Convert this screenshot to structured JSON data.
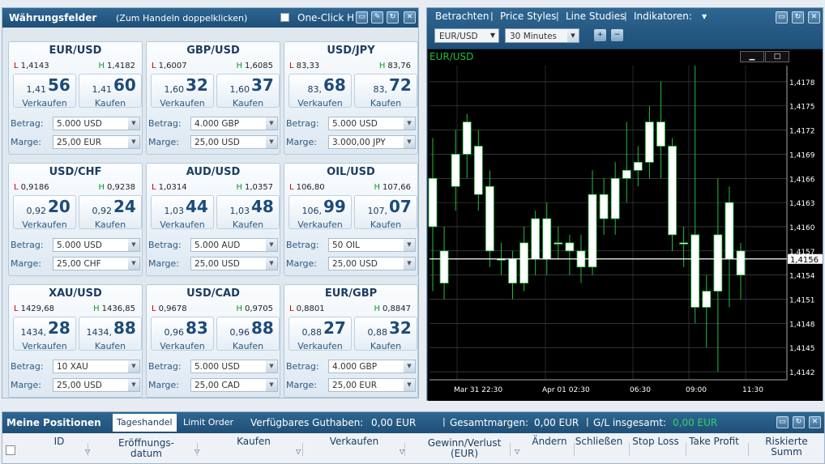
{
  "currency_panel": {
    "title": "Währungsfelder",
    "subtitle": "(Zum Handeln doppelklicken)",
    "oneclick": "One-Click H"
  },
  "labels": {
    "sell": "Verkaufen",
    "buy": "Kaufen",
    "amount": "Betrag:",
    "margin": "Marge:",
    "low": "L",
    "high": "H"
  },
  "cards": [
    {
      "pair": "EUR/USD",
      "low": "1,4143",
      "high": "1,4182",
      "sell_pre": "1,41",
      "sell_big": "56",
      "buy_pre": "1,41",
      "buy_big": "60",
      "amount": "5.000 USD",
      "margin": "25,00 EUR"
    },
    {
      "pair": "GBP/USD",
      "low": "1,6007",
      "high": "1,6085",
      "sell_pre": "1,60",
      "sell_big": "32",
      "buy_pre": "1,60",
      "buy_big": "37",
      "amount": "4.000 GBP",
      "margin": "25,00 USD"
    },
    {
      "pair": "USD/JPY",
      "low": "83,33",
      "high": "83,76",
      "sell_pre": "83,",
      "sell_big": "68",
      "buy_pre": "83,",
      "buy_big": "72",
      "amount": "5.000 USD",
      "margin": "3.000,00 JPY"
    },
    {
      "pair": "USD/CHF",
      "low": "0,9186",
      "high": "0,9238",
      "sell_pre": "0,92",
      "sell_big": "20",
      "buy_pre": "0,92",
      "buy_big": "24",
      "amount": "5.000 USD",
      "margin": "25,00 CHF"
    },
    {
      "pair": "AUD/USD",
      "low": "1,0314",
      "high": "1,0357",
      "sell_pre": "1,03",
      "sell_big": "44",
      "buy_pre": "1,03",
      "buy_big": "48",
      "amount": "5.000 AUD",
      "margin": "25,00 USD"
    },
    {
      "pair": "OIL/USD",
      "low": "106,80",
      "high": "107,66",
      "sell_pre": "106,",
      "sell_big": "99",
      "buy_pre": "107,",
      "buy_big": "07",
      "amount": "50 OIL",
      "margin": "25,00 USD"
    },
    {
      "pair": "XAU/USD",
      "low": "1429,68",
      "high": "1436,85",
      "sell_pre": "1434,",
      "sell_big": "28",
      "buy_pre": "1434,",
      "buy_big": "88",
      "amount": "10 XAU",
      "margin": "25,00 USD"
    },
    {
      "pair": "USD/CAD",
      "low": "0,9678",
      "high": "0,9705",
      "sell_pre": "0,96",
      "sell_big": "83",
      "buy_pre": "0,96",
      "buy_big": "88",
      "amount": "5.000 USD",
      "margin": "25,00 CAD"
    },
    {
      "pair": "EUR/GBP",
      "low": "0,8801",
      "high": "0,8847",
      "sell_pre": "0,88",
      "sell_big": "27",
      "buy_pre": "0,88",
      "buy_big": "32",
      "amount": "4.000 GBP",
      "margin": "25,00 EUR"
    }
  ],
  "chart_panel": {
    "menu": [
      "Betrachten",
      "Price Styles",
      "Line Studies",
      "Indikatoren:"
    ],
    "symbol": "EUR/USD",
    "timeframe": "30 Minutes",
    "label": "EUR/USD",
    "current_price": "1,4156"
  },
  "chart_data": {
    "type": "candlestick",
    "symbol": "EUR/USD",
    "y_ticks": [
      "1,4178",
      "1,4175",
      "1,4172",
      "1,4169",
      "1,4166",
      "1,4163",
      "1,4160",
      "1,4157",
      "1,4154",
      "1,4151",
      "1,4148",
      "1,4145",
      "1,4142"
    ],
    "x_ticks": [
      "Mar 31 22:30",
      "Apr 01 02:30",
      "06:30",
      "09:00",
      "11:30"
    ],
    "ylim": [
      1.4141,
      1.418
    ],
    "current": 1.4156,
    "candles": [
      {
        "o": 1.416,
        "c": 1.4166,
        "h": 1.4171,
        "l": 1.4152
      },
      {
        "o": 1.4157,
        "c": 1.4153,
        "h": 1.416,
        "l": 1.4151
      },
      {
        "o": 1.4165,
        "c": 1.4169,
        "h": 1.4172,
        "l": 1.4162
      },
      {
        "o": 1.4169,
        "c": 1.4173,
        "h": 1.4174,
        "l": 1.4166
      },
      {
        "o": 1.417,
        "c": 1.4164,
        "h": 1.4172,
        "l": 1.4162
      },
      {
        "o": 1.4165,
        "c": 1.4157,
        "h": 1.4167,
        "l": 1.4155
      },
      {
        "o": 1.4156,
        "c": 1.4156,
        "h": 1.4158,
        "l": 1.4154
      },
      {
        "o": 1.4156,
        "c": 1.4153,
        "h": 1.4157,
        "l": 1.4151
      },
      {
        "o": 1.4153,
        "c": 1.4158,
        "h": 1.416,
        "l": 1.4152
      },
      {
        "o": 1.4156,
        "c": 1.4161,
        "h": 1.4162,
        "l": 1.4154
      },
      {
        "o": 1.4161,
        "c": 1.4156,
        "h": 1.4163,
        "l": 1.4154
      },
      {
        "o": 1.4158,
        "c": 1.4158,
        "h": 1.416,
        "l": 1.4156
      },
      {
        "o": 1.4158,
        "c": 1.4157,
        "h": 1.4159,
        "l": 1.4154
      },
      {
        "o": 1.4157,
        "c": 1.4155,
        "h": 1.4159,
        "l": 1.4153
      },
      {
        "o": 1.4155,
        "c": 1.4164,
        "h": 1.4167,
        "l": 1.4154
      },
      {
        "o": 1.4164,
        "c": 1.4161,
        "h": 1.4166,
        "l": 1.4159
      },
      {
        "o": 1.4161,
        "c": 1.4166,
        "h": 1.4168,
        "l": 1.4159
      },
      {
        "o": 1.4166,
        "c": 1.4167,
        "h": 1.4173,
        "l": 1.4163
      },
      {
        "o": 1.4167,
        "c": 1.4168,
        "h": 1.417,
        "l": 1.4165
      },
      {
        "o": 1.4168,
        "c": 1.4173,
        "h": 1.4175,
        "l": 1.4166
      },
      {
        "o": 1.4173,
        "c": 1.417,
        "h": 1.4178,
        "l": 1.4166
      },
      {
        "o": 1.417,
        "c": 1.4159,
        "h": 1.4171,
        "l": 1.4157
      },
      {
        "o": 1.4158,
        "c": 1.4158,
        "h": 1.416,
        "l": 1.4155
      },
      {
        "o": 1.4159,
        "c": 1.415,
        "h": 1.418,
        "l": 1.4148
      },
      {
        "o": 1.415,
        "c": 1.4152,
        "h": 1.4154,
        "l": 1.4145
      },
      {
        "o": 1.4152,
        "c": 1.4159,
        "h": 1.4166,
        "l": 1.4142
      },
      {
        "o": 1.4163,
        "c": 1.4156,
        "h": 1.4165,
        "l": 1.415
      },
      {
        "o": 1.4157,
        "c": 1.4154,
        "h": 1.4158,
        "l": 1.4151
      }
    ]
  },
  "positions": {
    "title": "Meine Positionen",
    "tabs": [
      "Tageshandel",
      "Limit Order"
    ],
    "available_label": "Verfügbares Guthaben:",
    "available_value": "0,00 EUR",
    "margin_label": "Gesamtmargen:",
    "margin_value": "0,00 EUR",
    "pl_label": "G/L insgesamt:",
    "pl_value": "0,00 EUR",
    "columns": [
      "ID",
      "Eröffnungs-\ndatum",
      "Kaufen",
      "Verkaufen",
      "Gewinn/Verlust\n(EUR)",
      "Ändern",
      "Schließen",
      "Stop Loss",
      "Take Profit",
      "Riskierte Summ"
    ]
  }
}
